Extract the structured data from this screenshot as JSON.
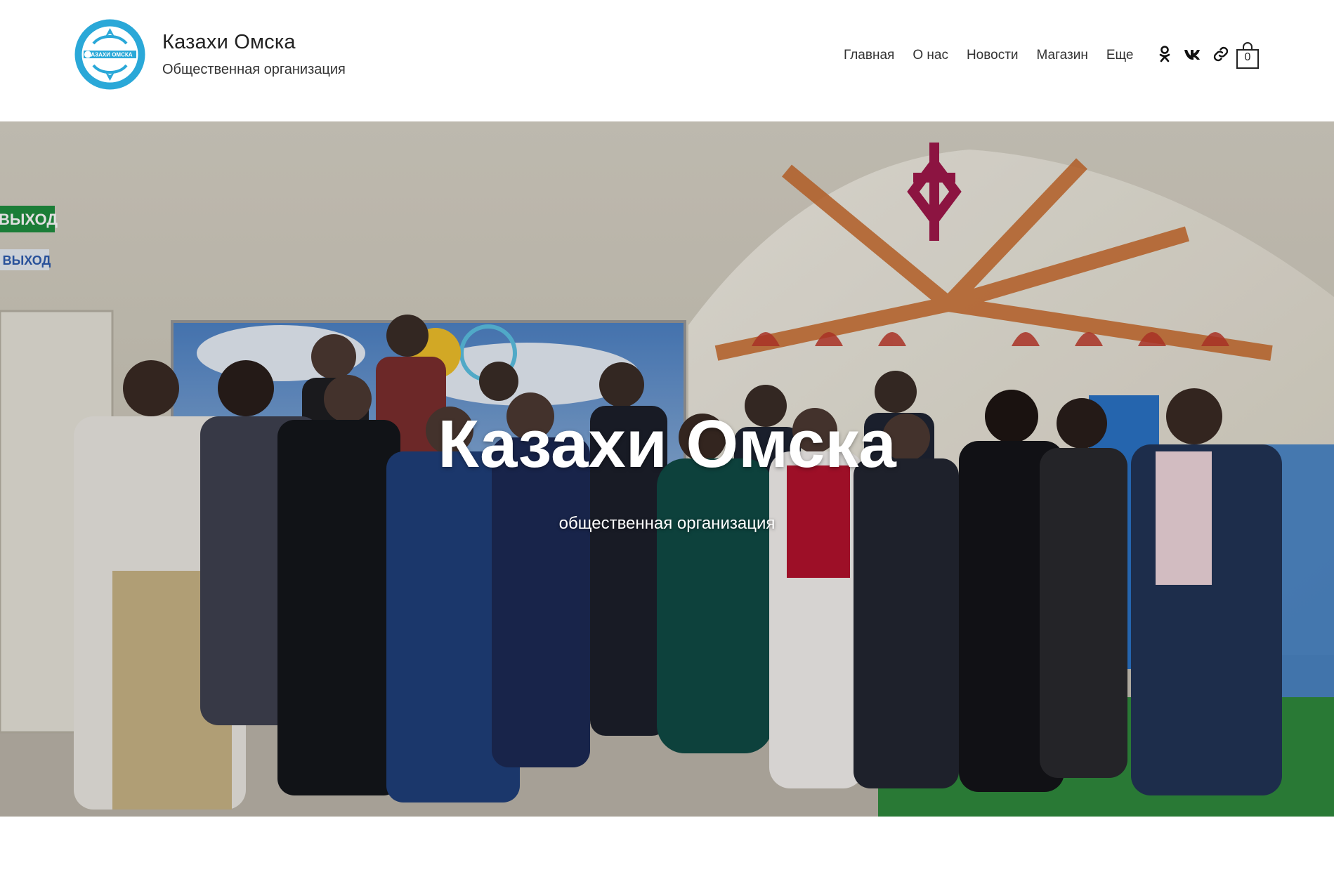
{
  "header": {
    "logo_text": "КАЗАХИ ОМСКА",
    "site_title": "Казахи Омска",
    "site_subtitle": "Общественная организация"
  },
  "nav": {
    "items": [
      {
        "label": "Главная"
      },
      {
        "label": "О нас"
      },
      {
        "label": "Новости"
      },
      {
        "label": "Магазин"
      },
      {
        "label": "Еще"
      }
    ]
  },
  "social": {
    "icons": [
      "odnoklassniki-icon",
      "vk-icon",
      "link-icon"
    ]
  },
  "cart": {
    "count": "0"
  },
  "hero": {
    "title": "Казахи Омска",
    "subtitle": "общественная организация",
    "signs": [
      "ВЫХОД",
      "ВЫХОД"
    ]
  },
  "colors": {
    "brand_blue": "#2aa8d8",
    "text": "#222222",
    "hero_text": "#ffffff"
  }
}
